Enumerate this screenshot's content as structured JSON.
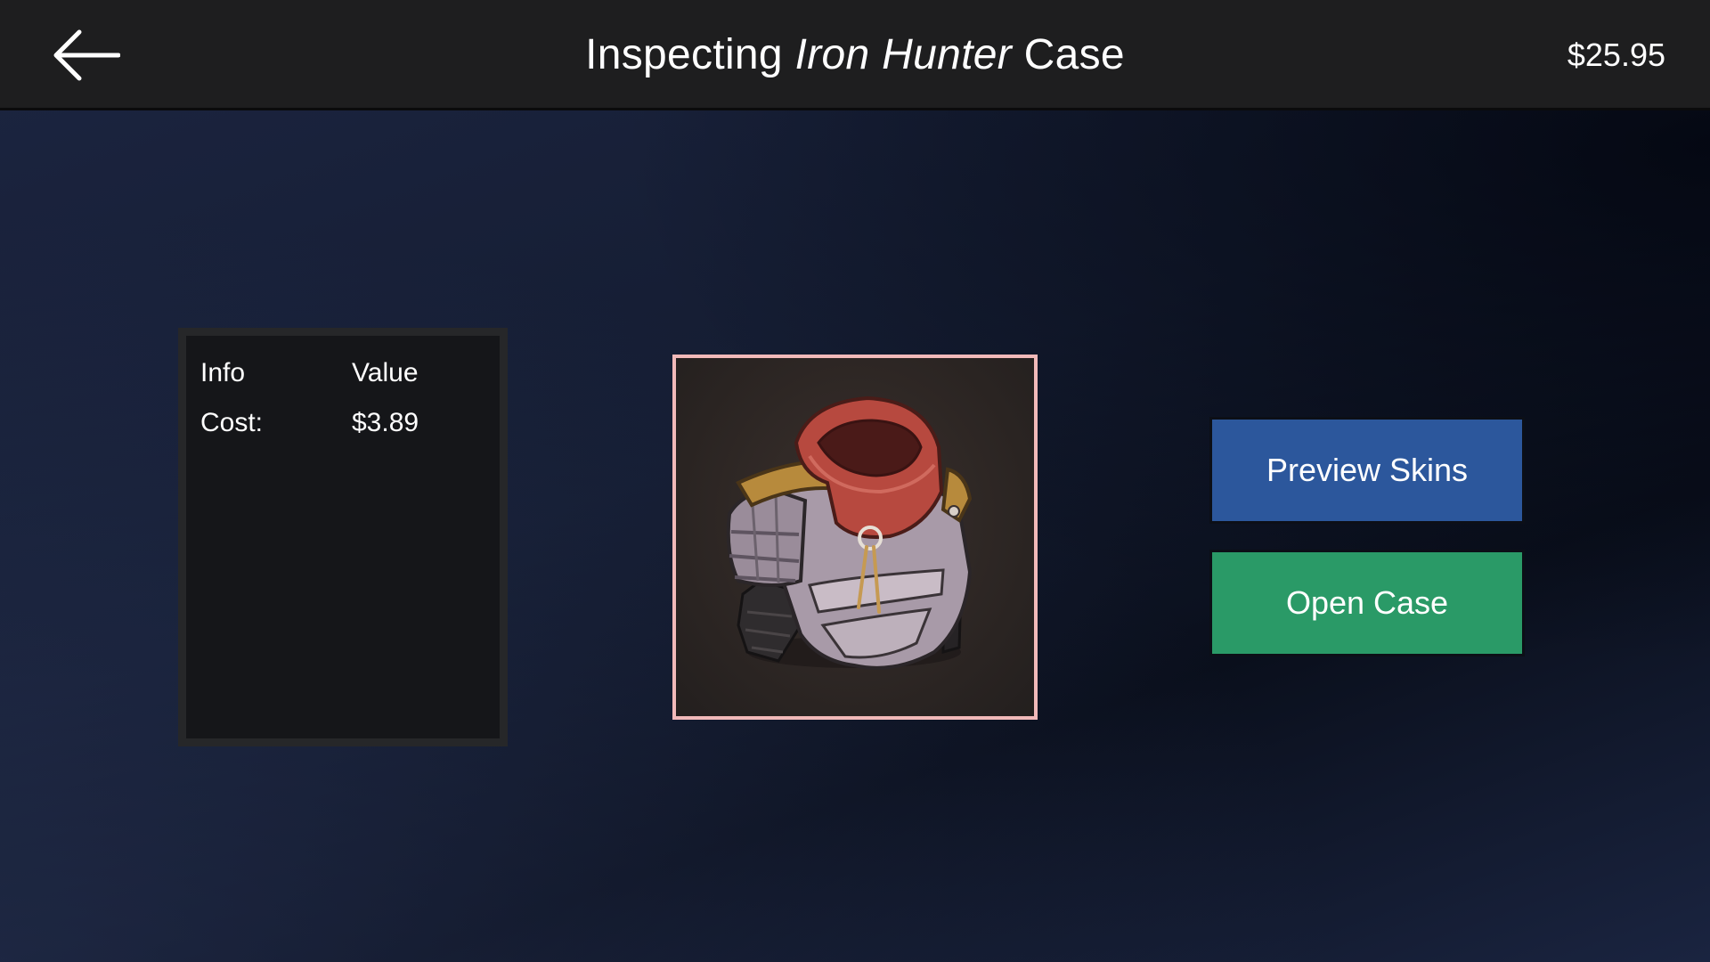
{
  "header": {
    "title_prefix": "Inspecting",
    "title_case_name": "Iron Hunter",
    "title_suffix": "Case",
    "balance": "$25.95",
    "back_icon": "arrow-left-icon"
  },
  "info_panel": {
    "columns": [
      "Info",
      "Value"
    ],
    "rows": [
      {
        "label": "Cost:",
        "value": "$3.89"
      }
    ]
  },
  "case_preview": {
    "image": "armor-chestplate-icon",
    "frame_color": "#f1b9b9"
  },
  "actions": {
    "preview_label": "Preview Skins",
    "open_label": "Open Case",
    "preview_color": "#2c579c",
    "open_color": "#2a9a67"
  }
}
